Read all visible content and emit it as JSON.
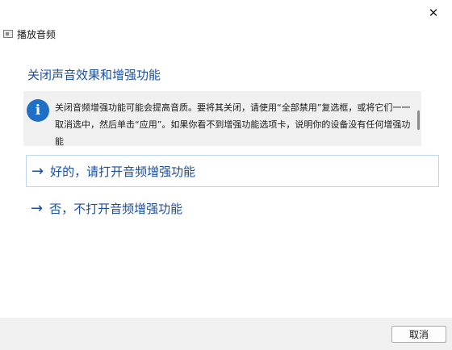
{
  "window": {
    "title": "播放音频",
    "close_glyph": "✕"
  },
  "main": {
    "heading": "关闭声音效果和增强功能",
    "info_text": "关闭音频增强功能可能会提高音质。要将其关闭，请使用“全部禁用”复选框，或将它们一一取消选中，然后单击“应用”。如果你看不到增强功能选项卡，说明你的设备没有任何增强功能",
    "info_icon_glyph": "i",
    "options": [
      {
        "arrow": "→",
        "label": "好的，请打开音频增强功能"
      },
      {
        "arrow": "→",
        "label": "否，不打开音频增强功能"
      }
    ]
  },
  "footer": {
    "cancel_label": "取消"
  },
  "colors": {
    "link_blue": "#1a4fa0",
    "info_icon_blue": "#1f6fc6",
    "info_bg": "#f0f0f0"
  }
}
